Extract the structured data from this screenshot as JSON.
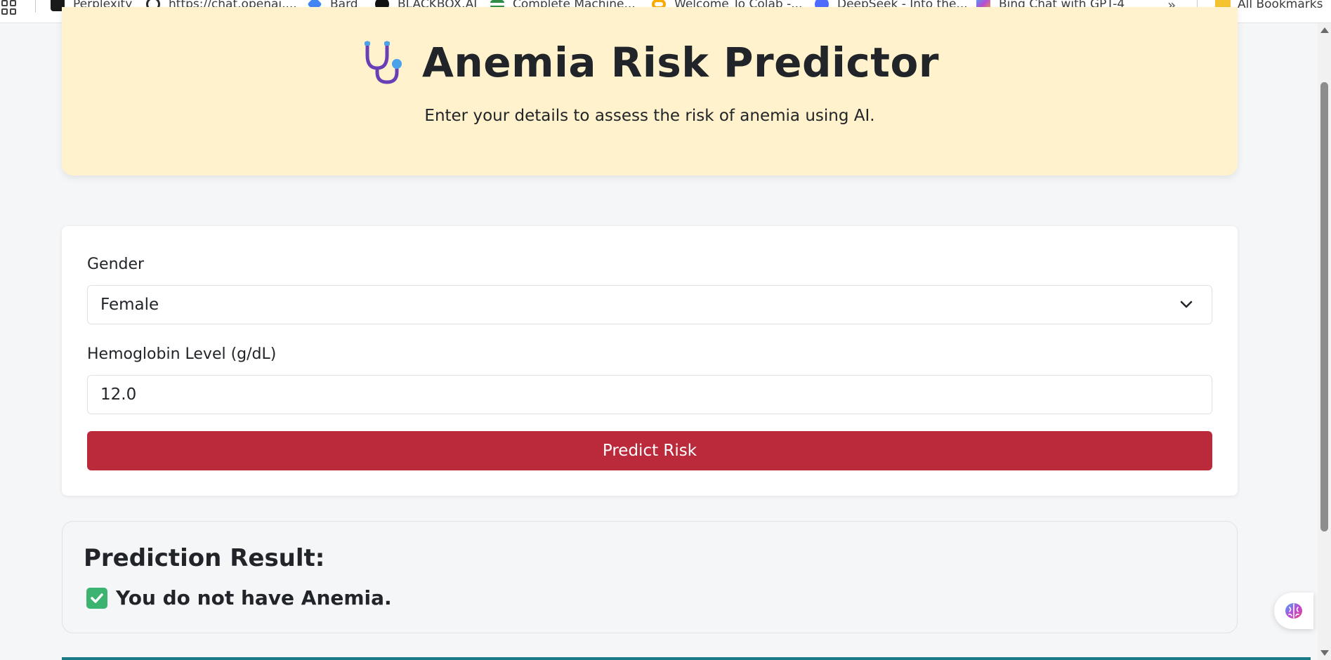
{
  "bookmarks": {
    "items": [
      {
        "label": "Perplexity",
        "icon": "perplexity-icon",
        "color": "#1a1a1a"
      },
      {
        "label": "https://chat.openai....",
        "icon": "openai-icon",
        "color": "#2b2b2b"
      },
      {
        "label": "Bard",
        "icon": "bard-icon",
        "color": "#4285f4"
      },
      {
        "label": "BLACKBOX.AI",
        "icon": "blackbox-icon",
        "color": "#111111"
      },
      {
        "label": "Complete Machine...",
        "icon": "geeksforgeeks-icon",
        "color": "#2f8d46"
      },
      {
        "label": "Welcome To Colab -...",
        "icon": "colab-icon",
        "color": "#f9ab00"
      },
      {
        "label": "DeepSeek - Into the...",
        "icon": "deepseek-icon",
        "color": "#4d6bfe"
      },
      {
        "label": "Bing Chat with GPT-4",
        "icon": "bing-chat-icon",
        "color": "#b84cd6"
      }
    ],
    "more": "»",
    "all_bookmarks": "All Bookmarks"
  },
  "hero": {
    "title": "Anemia Risk Predictor",
    "subtitle": "Enter your details to assess the risk of anemia using AI.",
    "background": "#fff2cc"
  },
  "form": {
    "gender_label": "Gender",
    "gender_value": "Female",
    "hemoglobin_label": "Hemoglobin Level (g/dL)",
    "hemoglobin_value": "12.0",
    "submit_label": "Predict Risk",
    "submit_color": "#bb2a3a"
  },
  "result": {
    "title": "Prediction Result:",
    "message": "You do not have Anemia.",
    "status_icon": "check-mark-icon"
  }
}
